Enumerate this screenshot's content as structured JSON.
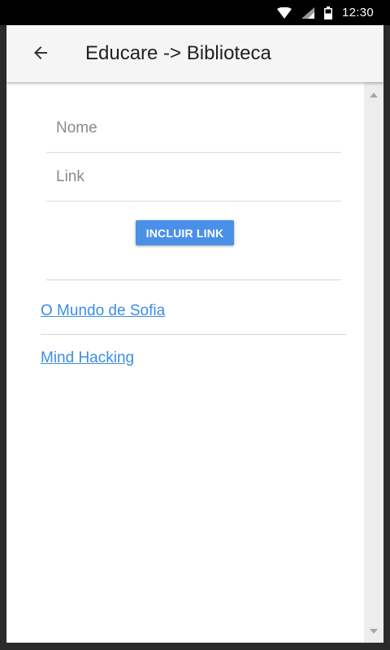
{
  "status_bar": {
    "time": "12:30",
    "icons": [
      "wifi-icon",
      "signal-icon",
      "battery-icon"
    ]
  },
  "app_bar": {
    "back_icon": "arrow-back-icon",
    "title": "Educare -> Biblioteca"
  },
  "form": {
    "nome": {
      "placeholder": "Nome",
      "value": ""
    },
    "link": {
      "placeholder": "Link",
      "value": ""
    },
    "include_button_label": "INCLUIR LINK"
  },
  "links": [
    {
      "label": "O Mundo de Sofia"
    },
    {
      "label": "Mind Hacking"
    }
  ],
  "colors": {
    "accent": "#4a90e8",
    "link": "#3a8ee6",
    "app_bar_bg": "#f5f5f5",
    "status_bar_bg": "#000000"
  }
}
